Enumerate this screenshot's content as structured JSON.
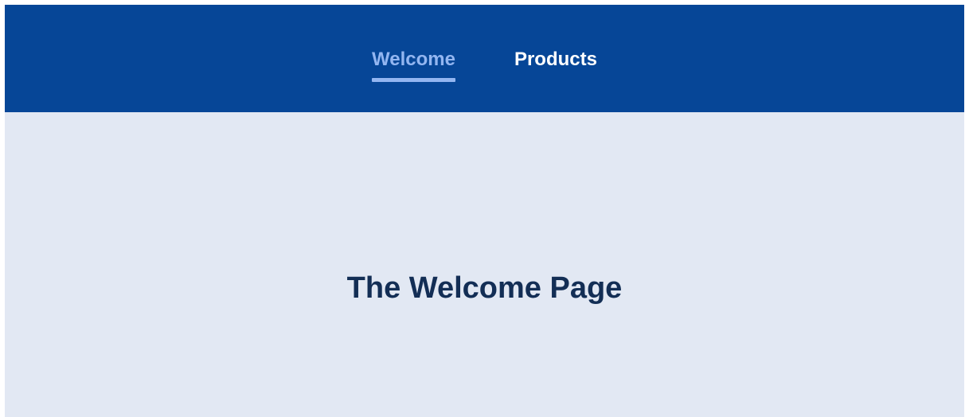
{
  "nav": {
    "items": [
      {
        "label": "Welcome",
        "active": true
      },
      {
        "label": "Products",
        "active": false
      }
    ]
  },
  "main": {
    "title": "The Welcome Page"
  },
  "colors": {
    "nav_background": "#064697",
    "nav_active": "#93b6f1",
    "page_background": "#e2e8f3",
    "title_text": "#132e55"
  }
}
